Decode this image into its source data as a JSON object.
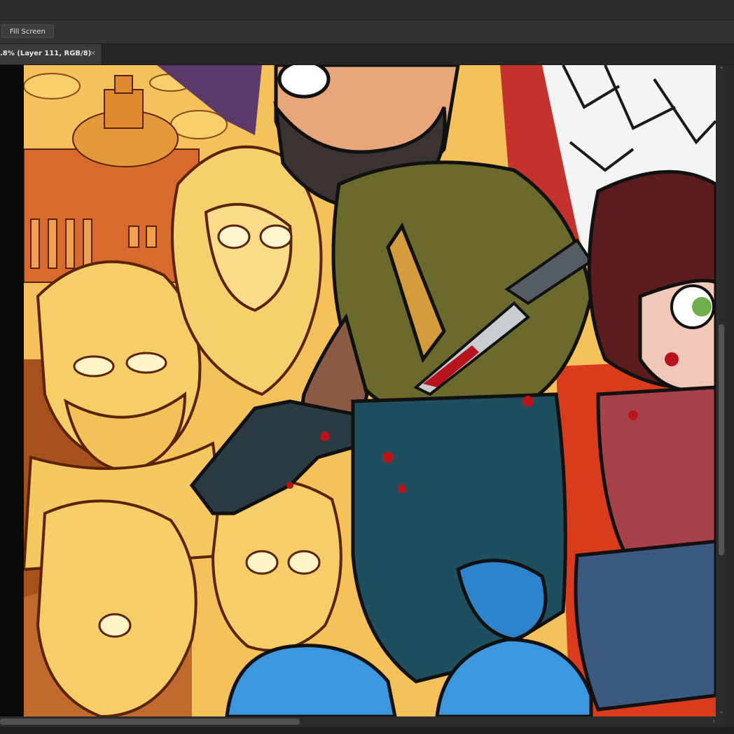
{
  "options_bar": {
    "fill_screen_label": "Fill Screen"
  },
  "document_tab": {
    "title": ".8% (Layer 111, RGB/8)",
    "close_glyph": "×"
  },
  "scrollbars": {
    "up_glyph": "⌃",
    "down_glyph": "⌄",
    "right_glyph": "›"
  },
  "colors": {
    "accent_workspace": "#282828",
    "canvas_yellow": "#f4c15a",
    "jacket_green": "#6b6a2c",
    "jeans_blue": "#1f4e5e",
    "hair_brown": "#5a1c1c",
    "zombie_blue": "#3d97df",
    "blood_red": "#b8141c"
  }
}
